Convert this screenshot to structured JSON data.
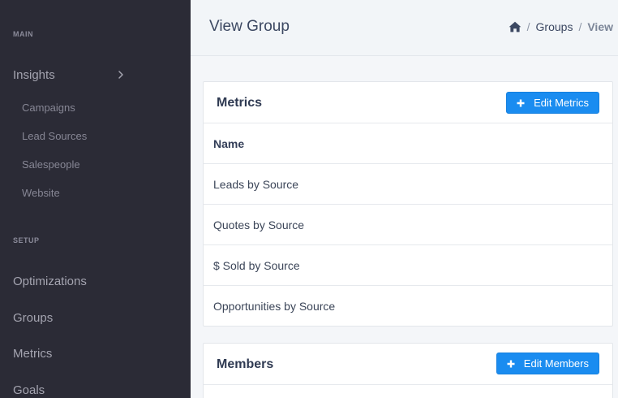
{
  "sidebar": {
    "sections": [
      {
        "label": "MAIN"
      },
      {
        "label": "SETUP"
      }
    ],
    "insights_label": "Insights",
    "insights_items": [
      {
        "label": "Campaigns"
      },
      {
        "label": "Lead Sources"
      },
      {
        "label": "Salespeople"
      },
      {
        "label": "Website"
      }
    ],
    "setup_items": [
      {
        "label": "Optimizations"
      },
      {
        "label": "Groups"
      },
      {
        "label": "Metrics"
      },
      {
        "label": "Goals"
      }
    ]
  },
  "header": {
    "title": "View Group",
    "breadcrumb": [
      {
        "label": "Groups"
      },
      {
        "label": "View"
      }
    ],
    "separator": "/"
  },
  "metrics_card": {
    "title": "Metrics",
    "button_label": "Edit Metrics",
    "column_header": "Name",
    "rows": [
      {
        "name": "Leads by Source"
      },
      {
        "name": "Quotes by Source"
      },
      {
        "name": "$ Sold by Source"
      },
      {
        "name": "Opportunities by Source"
      }
    ]
  },
  "members_card": {
    "title": "Members",
    "button_label": "Edit Members"
  },
  "colors": {
    "sidebar_bg": "#2b2b36",
    "accent": "#1a8cf0",
    "page_bg": "#f4f6f9"
  }
}
